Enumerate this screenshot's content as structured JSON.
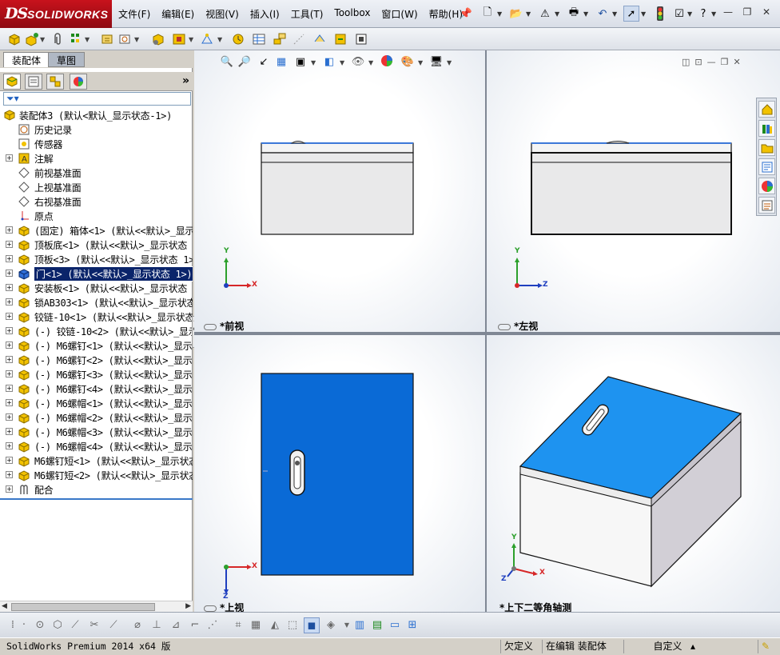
{
  "app": {
    "logo_ds": "DS",
    "logo_name": "SOLIDWORKS",
    "menus": [
      "文件(F)",
      "编辑(E)",
      "视图(V)",
      "插入(I)",
      "工具(T)",
      "Toolbox",
      "窗口(W)",
      "帮助(H)"
    ]
  },
  "feature_manager": {
    "tabs": [
      "装配体",
      "草图"
    ],
    "tree": [
      {
        "label": "装配体3  (默认<默认_显示状态-1>)",
        "icon": "assembly-icon",
        "expand": false,
        "indent": 0
      },
      {
        "label": "历史记录",
        "icon": "history-icon",
        "expand": false,
        "indent": 1
      },
      {
        "label": "传感器",
        "icon": "sensor-icon",
        "expand": false,
        "indent": 1
      },
      {
        "label": "注解",
        "icon": "annotation-icon",
        "expand": true,
        "indent": 1
      },
      {
        "label": "前视基准面",
        "icon": "plane-icon",
        "expand": false,
        "indent": 1
      },
      {
        "label": "上视基准面",
        "icon": "plane-icon",
        "expand": false,
        "indent": 1
      },
      {
        "label": "右视基准面",
        "icon": "plane-icon",
        "expand": false,
        "indent": 1
      },
      {
        "label": "原点",
        "icon": "origin-icon",
        "expand": false,
        "indent": 1
      },
      {
        "label": "(固定) 箱体<1> (默认<<默认>_显示状",
        "icon": "part-icon",
        "expand": true,
        "indent": 1
      },
      {
        "label": "顶板底<1> (默认<<默认>_显示状态 1",
        "icon": "part-icon",
        "expand": true,
        "indent": 1
      },
      {
        "label": "顶板<3> (默认<<默认>_显示状态 1>)",
        "icon": "part-icon",
        "expand": true,
        "indent": 1
      },
      {
        "label": "门<1> (默认<<默认>_显示状态 1>)",
        "icon": "part-selected-icon",
        "expand": true,
        "indent": 1,
        "selected": true
      },
      {
        "label": "安装板<1> (默认<<默认>_显示状态 1",
        "icon": "part-icon",
        "expand": true,
        "indent": 1
      },
      {
        "label": "锁AB303<1> (默认<<默认>_显示状态",
        "icon": "part-icon",
        "expand": true,
        "indent": 1
      },
      {
        "label": "铰链-10<1> (默认<<默认>_显示状态",
        "icon": "part-icon",
        "expand": true,
        "indent": 1
      },
      {
        "label": "(-) 铰链-10<2> (默认<<默认>_显示状",
        "icon": "part-icon",
        "expand": true,
        "indent": 1
      },
      {
        "label": "(-) M6螺钉<1> (默认<<默认>_显示状",
        "icon": "part-icon",
        "expand": true,
        "indent": 1
      },
      {
        "label": "(-) M6螺钉<2> (默认<<默认>_显示状",
        "icon": "part-icon",
        "expand": true,
        "indent": 1
      },
      {
        "label": "(-) M6螺钉<3> (默认<<默认>_显示状",
        "icon": "part-icon",
        "expand": true,
        "indent": 1
      },
      {
        "label": "(-) M6螺钉<4> (默认<<默认>_显示状",
        "icon": "part-icon",
        "expand": true,
        "indent": 1
      },
      {
        "label": "(-) M6螺帽<1> (默认<<默认>_显示状",
        "icon": "part-icon",
        "expand": true,
        "indent": 1
      },
      {
        "label": "(-) M6螺帽<2> (默认<<默认>_显示状",
        "icon": "part-icon",
        "expand": true,
        "indent": 1
      },
      {
        "label": "(-) M6螺帽<3> (默认<<默认>_显示状",
        "icon": "part-icon",
        "expand": true,
        "indent": 1
      },
      {
        "label": "(-) M6螺帽<4> (默认<<默认>_显示状",
        "icon": "part-icon",
        "expand": true,
        "indent": 1
      },
      {
        "label": "M6螺钉短<1> (默认<<默认>_显示状态",
        "icon": "part-icon",
        "expand": true,
        "indent": 1
      },
      {
        "label": "M6螺钉短<2> (默认<<默认>_显示状态",
        "icon": "part-icon",
        "expand": true,
        "indent": 1
      },
      {
        "label": "配合",
        "icon": "mates-icon",
        "expand": true,
        "indent": 1
      }
    ]
  },
  "viewports": {
    "front": "*前视",
    "left": "*左视",
    "top": "*上视",
    "iso": "*上下二等角轴测"
  },
  "axes": {
    "x": "X",
    "y": "Y",
    "z": "Z"
  },
  "colors": {
    "door_blue": "#0a6ad6",
    "top_blue": "#1e93f0",
    "selection": "#0a246a"
  },
  "statusbar": {
    "version": "SolidWorks Premium 2014 x64 版",
    "under_defined": "欠定义",
    "editing": "在编辑 装配体",
    "custom": "自定义"
  }
}
